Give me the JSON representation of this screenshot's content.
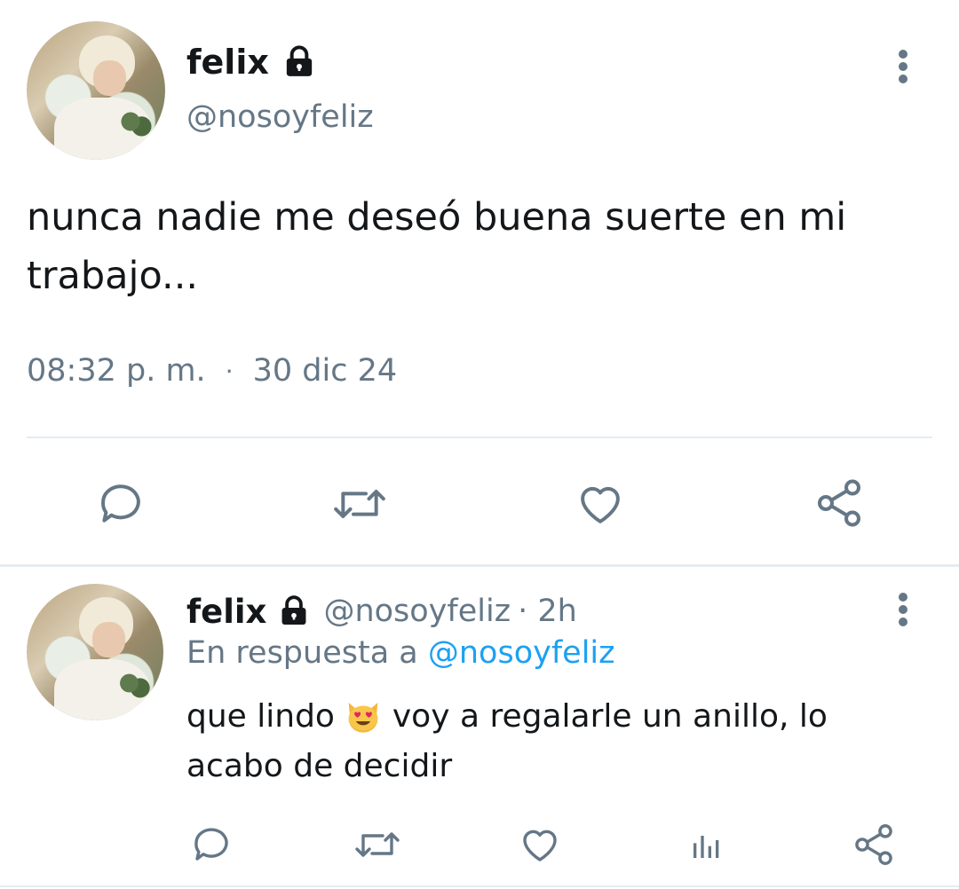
{
  "tweet": {
    "author_name": "felix",
    "author_handle": "@nosoyfeliz",
    "text_line1": "nunca nadie me deseó buena suerte en mi",
    "text_line2": "trabajo...",
    "time": "08:32 p. m.",
    "separator": "·",
    "date": "30 dic 24",
    "icons": [
      "more-vertical-icon",
      "lock-icon",
      "reply-icon",
      "retweet-icon",
      "like-icon",
      "share-icon"
    ]
  },
  "reply": {
    "author_name": "felix",
    "author_handle": "@nosoyfeliz",
    "age": "· 2h",
    "in_reply_prefix": "En respuesta a",
    "in_reply_handle": "@nosoyfeliz",
    "text_before_emoji": "que lindo",
    "emoji": "smiling-cat-heart-eyes-emoji",
    "text_after_emoji": "voy a regalarle un anillo, lo",
    "text_line2": "acabo de decidir",
    "icons": [
      "more-vertical-icon",
      "lock-icon",
      "reply-icon",
      "retweet-icon",
      "like-icon",
      "analytics-icon",
      "share-icon"
    ]
  },
  "colors": {
    "text": "#14171a",
    "secondary": "#657786",
    "link": "#1da1f2",
    "divider": "#e6ecf0"
  }
}
